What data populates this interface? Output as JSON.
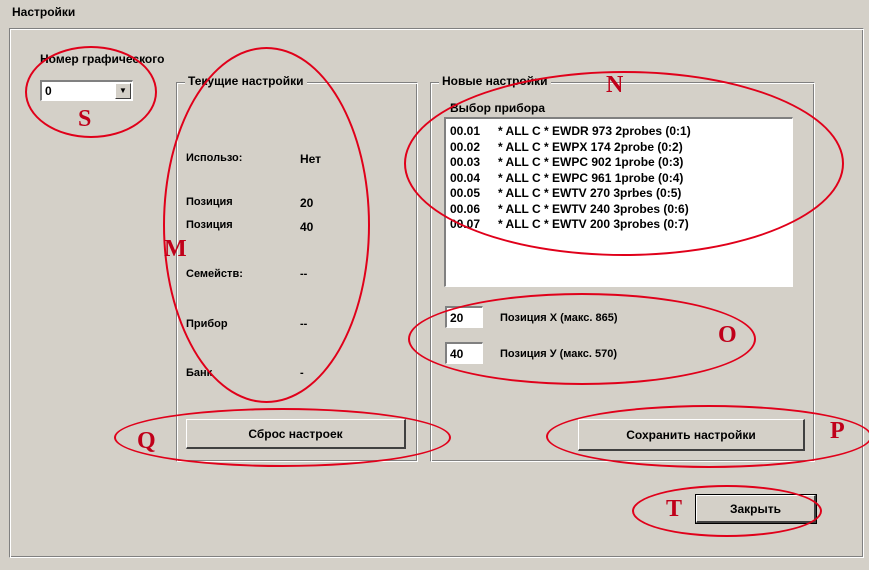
{
  "window": {
    "title": "Настройки"
  },
  "graph_number": {
    "label": "Номер графического",
    "value": "0"
  },
  "current": {
    "title": "Текущие настройки",
    "rows": [
      {
        "label": "Использо:",
        "value": "Нет"
      },
      {
        "label": "Позиция",
        "value": "20"
      },
      {
        "label": "Позиция",
        "value": "40"
      },
      {
        "label": "Семейств:",
        "value": "--"
      },
      {
        "label": "Прибор",
        "value": "--"
      },
      {
        "label": "Банк",
        "value": "-"
      }
    ]
  },
  "new": {
    "title": "Новые настройки",
    "device_label": "Выбор прибора",
    "devices": [
      {
        "code": "00.01",
        "text": "* ALL C * EWDR 973 2probes (0:1)"
      },
      {
        "code": "00.02",
        "text": "* ALL C * EWPX 174 2probe (0:2)"
      },
      {
        "code": "00.03",
        "text": "* ALL C * EWPC 902 1probe (0:3)"
      },
      {
        "code": "00.04",
        "text": "* ALL C * EWPC 961 1probe (0:4)"
      },
      {
        "code": "00.05",
        "text": "* ALL C * EWTV 270 3prbes (0:5)"
      },
      {
        "code": "00.06",
        "text": "* ALL C * EWTV 240 3probes (0:6)"
      },
      {
        "code": "00.07",
        "text": "* ALL C * EWTV 200 3probes (0:7)"
      }
    ],
    "pos_x": {
      "value": "20",
      "label": "Позиция X (макс. 865)"
    },
    "pos_y": {
      "value": "40",
      "label": "Позиция У (макс. 570)"
    }
  },
  "buttons": {
    "reset": "Сброс настроек",
    "save": "Сохранить настройки",
    "close": "Закрыть"
  },
  "annotations": {
    "s": "S",
    "m": "M",
    "n": "N",
    "o": "O",
    "p": "P",
    "q": "Q",
    "t": "T",
    "color": "#e0001a"
  }
}
